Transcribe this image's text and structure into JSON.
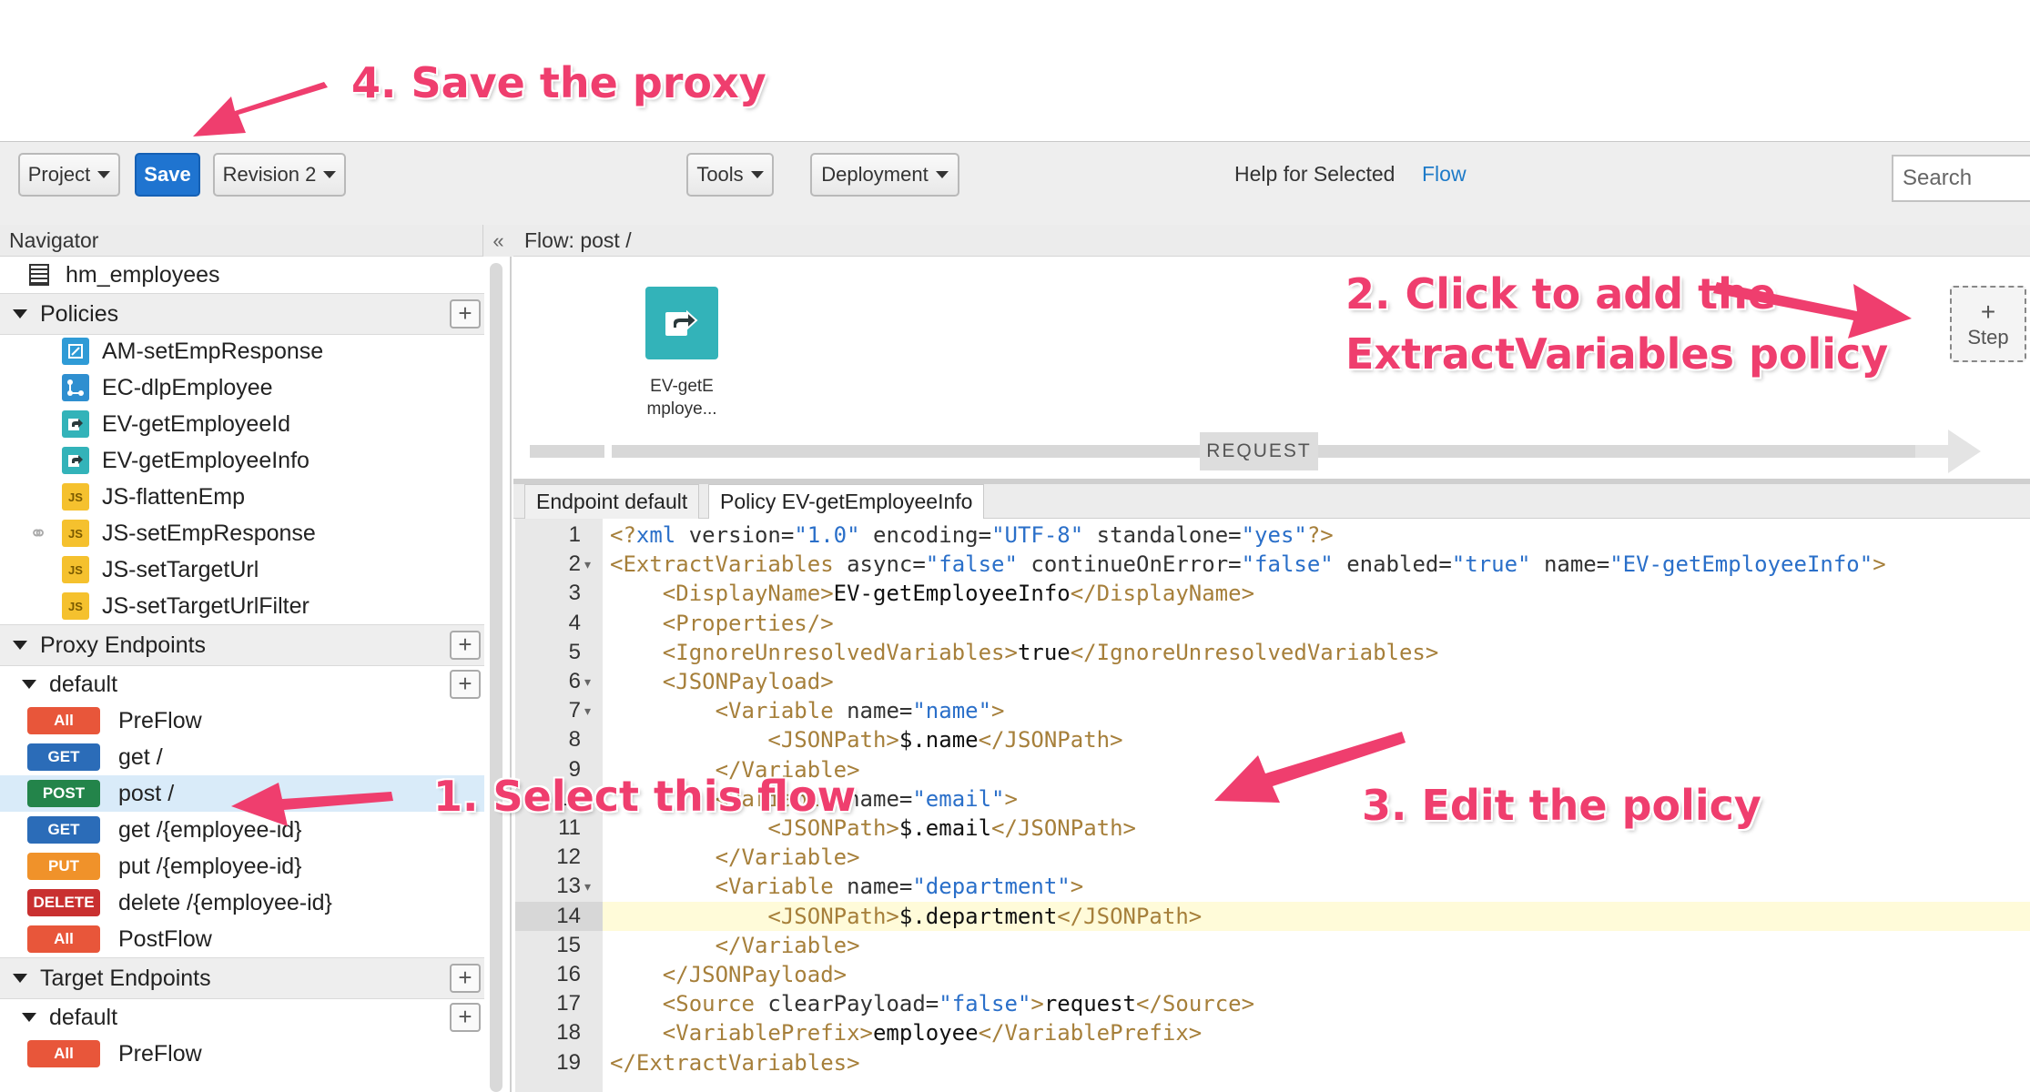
{
  "toolbar": {
    "project_label": "Project",
    "save_label": "Save",
    "revision_label": "Revision 2",
    "tools_label": "Tools",
    "deployment_label": "Deployment",
    "help_label": "Help for Selected",
    "help_link": "Flow",
    "search_placeholder": "Search"
  },
  "navigator": {
    "title": "Navigator",
    "collapse_glyph": "«",
    "proxy_name": "hm_employees",
    "policies_label": "Policies",
    "policies": [
      {
        "name": "AM-setEmpResponse",
        "icon": "assign-message-icon",
        "color": "#2f9bd6"
      },
      {
        "name": "EC-dlpEmployee",
        "icon": "extension-callout-icon",
        "color": "#2f8fd0"
      },
      {
        "name": "EV-getEmployeeId",
        "icon": "extract-variables-icon",
        "color": "#33b3b9"
      },
      {
        "name": "EV-getEmployeeInfo",
        "icon": "extract-variables-icon",
        "color": "#33b3b9"
      },
      {
        "name": "JS-flattenEmp",
        "icon": "javascript-icon",
        "color": "#f5c12e"
      },
      {
        "name": "JS-setEmpResponse",
        "icon": "javascript-icon",
        "color": "#f5c12e"
      },
      {
        "name": "JS-setTargetUrl",
        "icon": "javascript-icon",
        "color": "#f5c12e"
      },
      {
        "name": "JS-setTargetUrlFilter",
        "icon": "javascript-icon",
        "color": "#f5c12e"
      }
    ],
    "js_icon_text": "JS",
    "proxy_endpoints_label": "Proxy Endpoints",
    "proxy_default_label": "default",
    "proxy_flows": [
      {
        "method": "All",
        "color": "#e8563a",
        "name": "PreFlow",
        "selected": false
      },
      {
        "method": "GET",
        "color": "#2b6cb8",
        "name": "get /",
        "selected": false
      },
      {
        "method": "POST",
        "color": "#23844a",
        "name": "post /",
        "selected": true
      },
      {
        "method": "GET",
        "color": "#2b6cb8",
        "name": "get /{employee-id}",
        "selected": false
      },
      {
        "method": "PUT",
        "color": "#f0922a",
        "name": "put /{employee-id}",
        "selected": false
      },
      {
        "method": "DELETE",
        "color": "#c93030",
        "name": "delete /{employee-id}",
        "selected": false
      },
      {
        "method": "All",
        "color": "#e8563a",
        "name": "PostFlow",
        "selected": false
      }
    ],
    "target_endpoints_label": "Target Endpoints",
    "target_default_label": "default",
    "target_flows": [
      {
        "method": "All",
        "color": "#e8563a",
        "name": "PreFlow"
      }
    ]
  },
  "flow": {
    "header": "Flow: post /",
    "policy_caption_line1": "EV-getE",
    "policy_caption_line2": "mploye...",
    "step_plus": "+",
    "step_label": "Step",
    "request_label": "REQUEST"
  },
  "editor": {
    "tabs": [
      "Endpoint default",
      "Policy EV-getEmployeeInfo"
    ],
    "active_tab": 1,
    "highlighted_line": 14,
    "lines": [
      {
        "n": "1",
        "fold": false,
        "indent": 0,
        "parts": [
          [
            "tag",
            "<?"
          ],
          [
            "val",
            "xml"
          ],
          [
            "attr",
            " version="
          ],
          [
            "val",
            "\"1.0\""
          ],
          [
            "attr",
            " encoding="
          ],
          [
            "val",
            "\"UTF-8\""
          ],
          [
            "attr",
            " standalone="
          ],
          [
            "val",
            "\"yes\""
          ],
          [
            "tag",
            "?>"
          ]
        ]
      },
      {
        "n": "2",
        "fold": true,
        "indent": 0,
        "parts": [
          [
            "tag",
            "<ExtractVariables"
          ],
          [
            "attr",
            " async="
          ],
          [
            "val",
            "\"false\""
          ],
          [
            "attr",
            " continueOnError="
          ],
          [
            "val",
            "\"false\""
          ],
          [
            "attr",
            " enabled="
          ],
          [
            "val",
            "\"true\""
          ],
          [
            "attr",
            " name="
          ],
          [
            "val",
            "\"EV-getEmployeeInfo\""
          ],
          [
            "tag",
            ">"
          ]
        ]
      },
      {
        "n": "3",
        "fold": false,
        "indent": 1,
        "parts": [
          [
            "tag",
            "<DisplayName>"
          ],
          [
            "text",
            "EV-getEmployeeInfo"
          ],
          [
            "tag",
            "</DisplayName>"
          ]
        ]
      },
      {
        "n": "4",
        "fold": false,
        "indent": 1,
        "parts": [
          [
            "tag",
            "<Properties/>"
          ]
        ]
      },
      {
        "n": "5",
        "fold": false,
        "indent": 1,
        "parts": [
          [
            "tag",
            "<IgnoreUnresolvedVariables>"
          ],
          [
            "text",
            "true"
          ],
          [
            "tag",
            "</IgnoreUnresolvedVariables>"
          ]
        ]
      },
      {
        "n": "6",
        "fold": true,
        "indent": 1,
        "parts": [
          [
            "tag",
            "<JSONPayload>"
          ]
        ]
      },
      {
        "n": "7",
        "fold": true,
        "indent": 2,
        "parts": [
          [
            "tag",
            "<Variable"
          ],
          [
            "attr",
            " name="
          ],
          [
            "val",
            "\"name\""
          ],
          [
            "tag",
            ">"
          ]
        ]
      },
      {
        "n": "8",
        "fold": false,
        "indent": 3,
        "parts": [
          [
            "tag",
            "<JSONPath>"
          ],
          [
            "text",
            "$.name"
          ],
          [
            "tag",
            "</JSONPath>"
          ]
        ]
      },
      {
        "n": "9",
        "fold": false,
        "indent": 2,
        "parts": [
          [
            "tag",
            "</Variable>"
          ]
        ]
      },
      {
        "n": "10",
        "fold": true,
        "indent": 2,
        "parts": [
          [
            "tag",
            "<Variable"
          ],
          [
            "attr",
            " name="
          ],
          [
            "val",
            "\"email\""
          ],
          [
            "tag",
            ">"
          ]
        ]
      },
      {
        "n": "11",
        "fold": false,
        "indent": 3,
        "parts": [
          [
            "tag",
            "<JSONPath>"
          ],
          [
            "text",
            "$.email"
          ],
          [
            "tag",
            "</JSONPath>"
          ]
        ]
      },
      {
        "n": "12",
        "fold": false,
        "indent": 2,
        "parts": [
          [
            "tag",
            "</Variable>"
          ]
        ]
      },
      {
        "n": "13",
        "fold": true,
        "indent": 2,
        "parts": [
          [
            "tag",
            "<Variable"
          ],
          [
            "attr",
            " name="
          ],
          [
            "val",
            "\"department\""
          ],
          [
            "tag",
            ">"
          ]
        ]
      },
      {
        "n": "14",
        "fold": false,
        "indent": 3,
        "parts": [
          [
            "tag",
            "<JSONPath>"
          ],
          [
            "text",
            "$.department"
          ],
          [
            "tag",
            "</JSONPath>"
          ]
        ]
      },
      {
        "n": "15",
        "fold": false,
        "indent": 2,
        "parts": [
          [
            "tag",
            "</Variable>"
          ]
        ]
      },
      {
        "n": "16",
        "fold": false,
        "indent": 1,
        "parts": [
          [
            "tag",
            "</JSONPayload>"
          ]
        ]
      },
      {
        "n": "17",
        "fold": false,
        "indent": 1,
        "parts": [
          [
            "tag",
            "<Source"
          ],
          [
            "attr",
            " clearPayload="
          ],
          [
            "val",
            "\"false\""
          ],
          [
            "tag",
            ">"
          ],
          [
            "text",
            "request"
          ],
          [
            "tag",
            "</Source>"
          ]
        ]
      },
      {
        "n": "18",
        "fold": false,
        "indent": 1,
        "parts": [
          [
            "tag",
            "<VariablePrefix>"
          ],
          [
            "text",
            "employee"
          ],
          [
            "tag",
            "</VariablePrefix>"
          ]
        ]
      },
      {
        "n": "19",
        "fold": false,
        "indent": 0,
        "parts": [
          [
            "tag",
            "</ExtractVariables>"
          ]
        ]
      }
    ]
  },
  "annotations": {
    "save": "4. Save the proxy",
    "add_line1": "2. Click to add the",
    "add_line2": "ExtractVariables policy",
    "select": "1. Select this flow",
    "edit": "3. Edit the policy",
    "color": "#ef3e6e"
  }
}
